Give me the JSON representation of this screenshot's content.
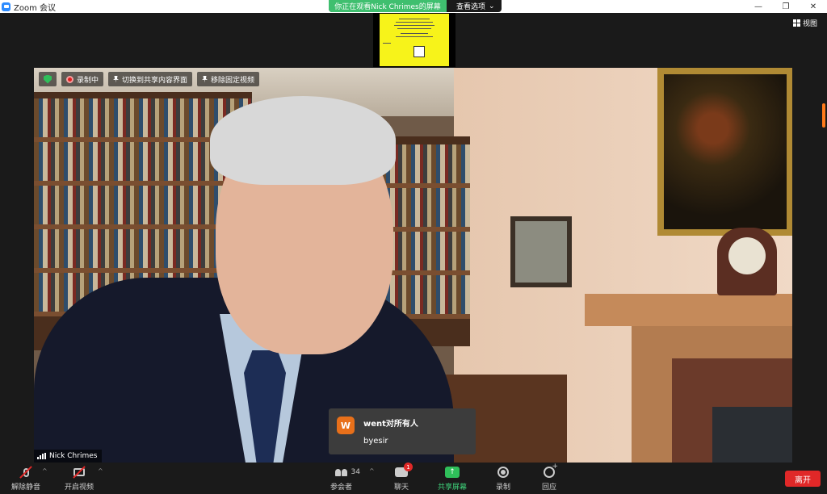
{
  "window": {
    "title": "Zoom 会议",
    "controls": {
      "minimize": "—",
      "maximize": "❐",
      "close": "✕"
    }
  },
  "share_banner": {
    "text": "你正在观看Nick Chrimes的屏幕",
    "options_label": "查看选项",
    "options_caret": "⌄"
  },
  "view_button": {
    "icon": "grid-icon",
    "label": "视图"
  },
  "video_overlay": {
    "recording_label": "录制中",
    "switch_share_label": "切换到共享内容界面",
    "unpin_label": "移除固定视频",
    "participant_name": "Nick Chrimes"
  },
  "chat_popup": {
    "avatar_letter": "W",
    "from": "went对所有人",
    "message": "byesir",
    "avatar_color": "#e8701a"
  },
  "toolbar": {
    "unmute_label": "解除静音",
    "start_video_label": "开启视频",
    "participants_label": "参会者",
    "participants_count": "34",
    "chat_label": "聊天",
    "chat_badge": "1",
    "share_label": "共享屏幕",
    "record_label": "录制",
    "reactions_label": "回应",
    "leave_label": "离开",
    "caret": "^"
  },
  "colors": {
    "share_green": "#3fbf6f",
    "leave_red": "#e02828",
    "recording_red": "#e02020",
    "security_green": "#2fbf5a",
    "thumbnail_yellow": "#f7f31a"
  }
}
